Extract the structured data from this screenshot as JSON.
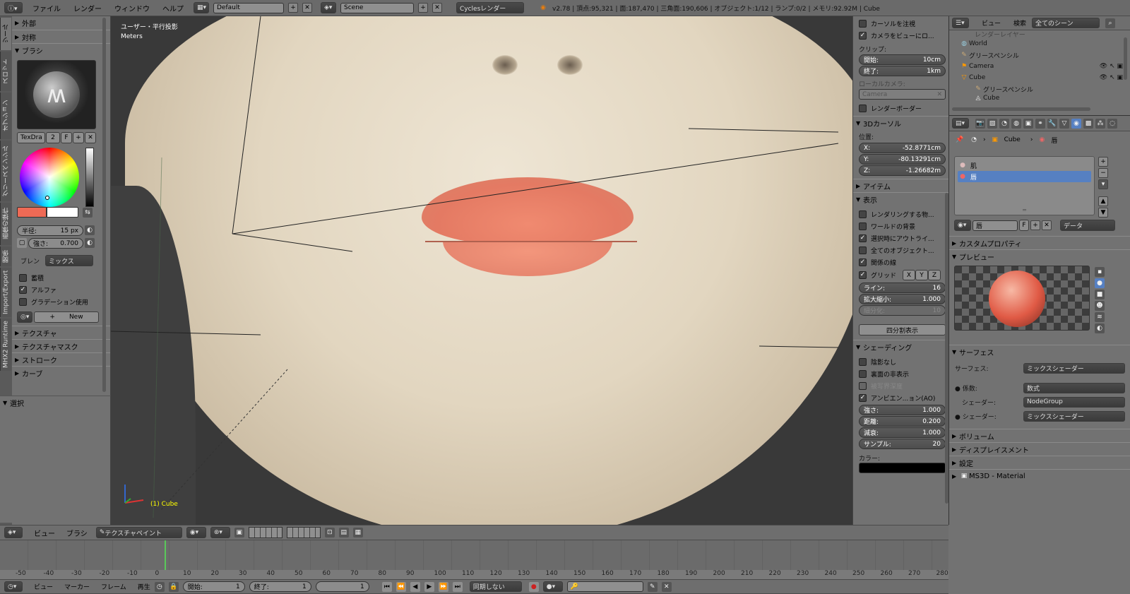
{
  "topbar": {
    "menus": [
      "ファイル",
      "レンダー",
      "ウィンドウ",
      "ヘルプ"
    ],
    "layout": "Default",
    "scene": "Scene",
    "engine": "Cyclesレンダー",
    "stats": "v2.78 | 頂点:95,321 | 面:187,470 | 三角面:190,606 | オブジェクト:1/12 | ランプ:0/2 | メモリ:92.92M | Cube"
  },
  "toolshelf": {
    "vtabs": [
      "ツール",
      "スロット",
      "オプション",
      "グリースペンシル",
      "画像の操作",
      "関係",
      "Import/Export",
      "MHX2 Runtime"
    ],
    "panels": {
      "outer": "外部",
      "symmetry": "対称",
      "brush": "ブラシ",
      "texture": "テクスチャ",
      "texmask": "テクスチャマスク",
      "stroke": "ストローク",
      "curve": "カーブ",
      "select": "選択"
    },
    "brush_name": "TexDra",
    "brush_users": "2",
    "brush_f": "F",
    "radius_label": "半径:",
    "radius_value": "15 px",
    "strength_label": "強さ:",
    "strength_value": "0.700",
    "blend_label": "ブレン",
    "blend_value": "ミックス",
    "opts": [
      {
        "label": "蓄積",
        "checked": false
      },
      {
        "label": "アルファ",
        "checked": true
      },
      {
        "label": "グラデーション使用",
        "checked": false
      }
    ],
    "new_label": "New",
    "colors": {
      "primary": "#ef6a55",
      "secondary": "#ffffff"
    }
  },
  "viewport": {
    "view_name": "ユーザー・平行投影",
    "units": "Meters",
    "object_label": "(1) Cube"
  },
  "npanel": {
    "cursor_lock": "カーソルを注視",
    "camera_lock": "カメラをビューにロ...",
    "clip_label": "クリップ:",
    "clip_start_label": "開始:",
    "clip_start": "10cm",
    "clip_end_label": "終了:",
    "clip_end": "1km",
    "local_cam": "ローカルカメラ:",
    "camera": "Camera",
    "render_border": "レンダーボーダー",
    "cursor_panel": "3Dカーソル",
    "location": "位置:",
    "x_label": "X:",
    "x": "-52.8771cm",
    "y_label": "Y:",
    "y": "-80.13291cm",
    "z_label": "Z:",
    "z": "-1.26682m",
    "item_panel": "アイテム",
    "display_panel": "表示",
    "display_opts": [
      {
        "label": "レンダリングする物...",
        "checked": false
      },
      {
        "label": "ワールドの背景",
        "checked": false
      },
      {
        "label": "選択時にアウトライ...",
        "checked": true
      },
      {
        "label": "全てのオブジェクト...",
        "checked": false
      },
      {
        "label": "関係の線",
        "checked": true
      }
    ],
    "grid_label": "グリッド",
    "axes": [
      "X",
      "Y",
      "Z"
    ],
    "lines_label": "ライン:",
    "lines": "16",
    "scale_label": "拡大縮小:",
    "scale": "1.000",
    "subdiv_label": "細分化:",
    "subdiv": "10",
    "quadview": "四分割表示",
    "shading_panel": "シェーディング",
    "shading_opts": [
      {
        "label": "陰影なし",
        "checked": false,
        "dis": false
      },
      {
        "label": "裏面の非表示",
        "checked": false,
        "dis": false
      },
      {
        "label": "被写界深度",
        "checked": false,
        "dis": true
      },
      {
        "label": "アンビエン...ョン(AO)",
        "checked": true,
        "dis": false
      }
    ],
    "ao": [
      {
        "label": "強さ:",
        "value": "1.000"
      },
      {
        "label": "距離:",
        "value": "0.200"
      },
      {
        "label": "減衰:",
        "value": "1.000"
      },
      {
        "label": "サンプル:",
        "value": "20"
      }
    ],
    "color_label": "カラー:"
  },
  "outliner": {
    "menus": [
      "ビュー",
      "検索"
    ],
    "filter": "全てのシーン",
    "items": [
      {
        "label": "レンダーレイヤー",
        "indent": 1
      },
      {
        "label": "World",
        "indent": 1
      },
      {
        "label": "グリースペンシル",
        "indent": 1
      },
      {
        "label": "Camera",
        "indent": 1
      },
      {
        "label": "Cube",
        "indent": 1
      },
      {
        "label": "グリースペンシル",
        "indent": 2
      },
      {
        "label": "Cube",
        "indent": 2
      }
    ]
  },
  "properties": {
    "breadcrumb": [
      "Cube",
      "唇"
    ],
    "slots": [
      "肌",
      "唇"
    ],
    "selected_slot": 1,
    "material_name": "唇",
    "material_f": "F",
    "data_dropdown": "データ",
    "panels": {
      "custom": "カスタムプロパティ",
      "preview": "プレビュー",
      "surface": "サーフェス",
      "volume": "ボリューム",
      "displace": "ディスプレイスメント",
      "settings": "設定",
      "ms3d": "MS3D - Material"
    },
    "surface_label": "サーフェス:",
    "surface_value": "ミックスシェーダー",
    "fac_label": "係数:",
    "fac_value": "数式",
    "shader1_label": "シェーダー:",
    "shader1_value": "NodeGroup",
    "shader2_label": "シェーダー:",
    "shader2_value": "ミックスシェーダー"
  },
  "view3d_header": {
    "menus": [
      "ビュー",
      "ブラシ"
    ],
    "mode": "テクスチャペイント"
  },
  "timeline": {
    "ticks": [
      "-50",
      "-40",
      "-30",
      "-20",
      "-10",
      "0",
      "10",
      "20",
      "30",
      "40",
      "50",
      "60",
      "70",
      "80",
      "90",
      "100",
      "110",
      "120",
      "130",
      "140",
      "150",
      "160",
      "170",
      "180",
      "190",
      "200",
      "210",
      "220",
      "230",
      "240",
      "250",
      "260",
      "270",
      "280"
    ],
    "current_frame": 1,
    "menus": [
      "ビュー",
      "マーカー",
      "フレーム",
      "再生"
    ],
    "start_label": "開始:",
    "start": "1",
    "end_label": "終了:",
    "end": "1",
    "frame": "1",
    "sync": "同期しない"
  }
}
